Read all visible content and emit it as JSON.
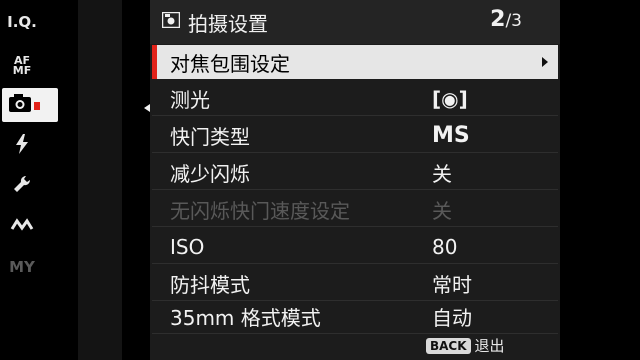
{
  "header": {
    "title": "拍摄设置",
    "page_current": "2",
    "page_total": "/3"
  },
  "left_tabs": [
    {
      "label": "I.Q."
    },
    {
      "label": "AF\nMF"
    },
    {
      "label": "shooting-camera"
    },
    {
      "label": "flash"
    },
    {
      "label": "setup-wrench"
    },
    {
      "label": "connection"
    },
    {
      "label": "MY"
    }
  ],
  "menu": {
    "items": [
      {
        "label": "对焦包围设定",
        "value": ""
      },
      {
        "label": "测光",
        "value": "[◉]"
      },
      {
        "label": "快门类型",
        "value": "MS"
      },
      {
        "label": "减少闪烁",
        "value": "关"
      },
      {
        "label": "无闪烁快门速度设定",
        "value": "关"
      },
      {
        "label": "ISO",
        "value": "80"
      },
      {
        "label": "防抖模式",
        "value": "常时"
      },
      {
        "label": "35mm 格式模式",
        "value": "自动"
      }
    ]
  },
  "footer": {
    "back_key": "BACK",
    "back_label": "退出"
  }
}
